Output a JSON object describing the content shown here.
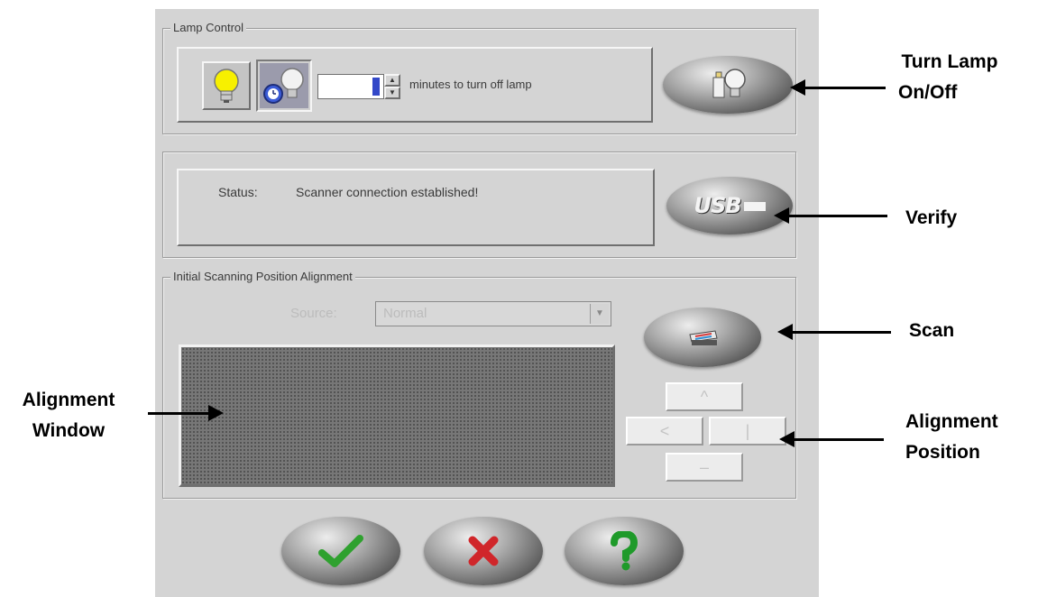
{
  "lamp_control": {
    "legend": "Lamp Control",
    "minutes_value": "",
    "minutes_label": "minutes to turn off lamp"
  },
  "status": {
    "label": "Status:",
    "message": "Scanner connection established!"
  },
  "alignment": {
    "legend": "Initial Scanning Position Alignment",
    "source_label": "Source:",
    "source_value": "Normal"
  },
  "nav": {
    "up": "^",
    "left": "<",
    "right": "|",
    "down": "–"
  },
  "callouts": {
    "turn_lamp_line1": "Turn Lamp",
    "turn_lamp_line2": "On/Off",
    "verify": "Verify",
    "scan": "Scan",
    "alignment_window_line1": "Alignment",
    "alignment_window_line2": "Window",
    "alignment_position_line1": "Alignment",
    "alignment_position_line2": "Position"
  },
  "icons": {
    "usb_text": "USB"
  },
  "colors": {
    "panel_bg": "#d4d4d4",
    "ok_green": "#2fa12f",
    "cancel_red": "#d0262a",
    "help_green": "#1f9a2a",
    "bulb_yellow": "#f7f000"
  }
}
